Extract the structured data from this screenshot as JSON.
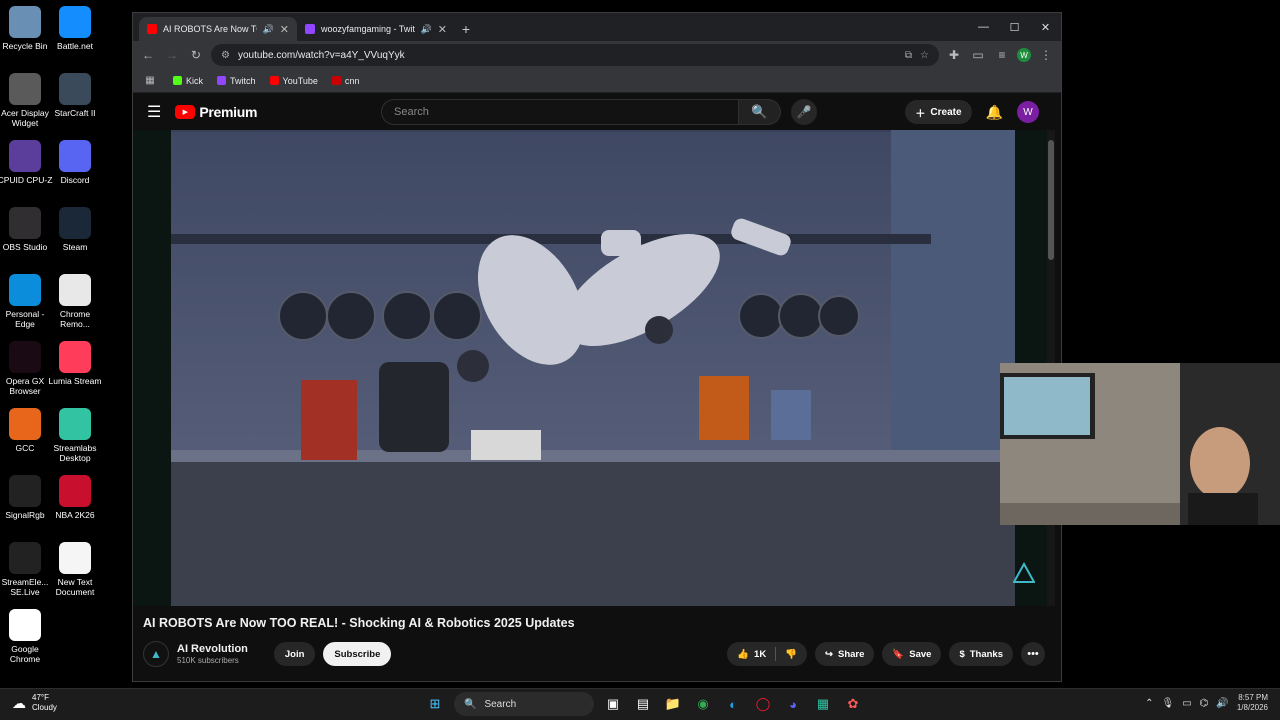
{
  "desktop": {
    "icons": [
      {
        "label": "Recycle Bin",
        "icon": "recycle-bin-icon",
        "color": "#6a8fb5"
      },
      {
        "label": "Battle.net",
        "icon": "battlenet-icon",
        "color": "#148eff"
      },
      {
        "label": "Acer Display Widget",
        "icon": "acer-icon",
        "color": "#5a5a5a"
      },
      {
        "label": "StarCraft II",
        "icon": "starcraft-icon",
        "color": "#3a4a5a"
      },
      {
        "label": "CPUID CPU-Z",
        "icon": "cpuz-icon",
        "color": "#5b3d9b"
      },
      {
        "label": "Discord",
        "icon": "discord-icon",
        "color": "#5865f2"
      },
      {
        "label": "OBS Studio",
        "icon": "obs-icon",
        "color": "#302e31"
      },
      {
        "label": "Steam",
        "icon": "steam-icon",
        "color": "#1b2838"
      },
      {
        "label": "Personal - Edge",
        "icon": "edge-icon",
        "color": "#0c8ddb"
      },
      {
        "label": "Chrome Remo...",
        "icon": "chrome-remote-icon",
        "color": "#e8e8e8"
      },
      {
        "label": "Opera GX Browser",
        "icon": "opera-gx-icon",
        "color": "#1a0a14"
      },
      {
        "label": "Lumia Stream",
        "icon": "lumia-icon",
        "color": "#ff3c5a"
      },
      {
        "label": "GCC",
        "icon": "gcc-icon",
        "color": "#e8661c"
      },
      {
        "label": "Streamlabs Desktop",
        "icon": "streamlabs-icon",
        "color": "#31c3a2"
      },
      {
        "label": "SignalRgb",
        "icon": "signalrgb-icon",
        "color": "#222"
      },
      {
        "label": "NBA 2K26",
        "icon": "nba2k-icon",
        "color": "#c8102e"
      },
      {
        "label": "StreamEle... SE.Live",
        "icon": "streamelements-icon",
        "color": "#222"
      },
      {
        "label": "New Text Document",
        "icon": "text-document-icon",
        "color": "#f5f5f5"
      },
      {
        "label": "Google Chrome",
        "icon": "chrome-icon",
        "color": "#ffffff"
      }
    ]
  },
  "browser": {
    "tabs": [
      {
        "title": "AI ROBOTS Are Now TOO R",
        "favicon_color": "#ff0000",
        "active": true
      },
      {
        "title": "woozyfamgaming - Twitch",
        "favicon_color": "#9146ff",
        "active": false
      }
    ],
    "url": "youtube.com/watch?v=a4Y_VVuqYyk",
    "profile_initial": "W",
    "bookmarks": [
      {
        "label": "Kick",
        "color": "#53fc18"
      },
      {
        "label": "Twitch",
        "color": "#9146ff"
      },
      {
        "label": "YouTube",
        "color": "#ff0000"
      },
      {
        "label": "cnn",
        "color": "#cc0000"
      }
    ]
  },
  "youtube": {
    "logo_text": "Premium",
    "search_placeholder": "Search",
    "create_label": "Create",
    "user_initial": "W",
    "video": {
      "title": "AI ROBOTS Are Now TOO REAL! - Shocking AI & Robotics 2025 Updates",
      "channel": "AI Revolution",
      "subscribers": "510K subscribers",
      "join_label": "Join",
      "subscribe_label": "Subscribe",
      "likes": "1K",
      "share_label": "Share",
      "save_label": "Save",
      "thanks_label": "Thanks"
    }
  },
  "taskbar": {
    "weather_temp": "47°F",
    "weather_desc": "Cloudy",
    "search_label": "Search",
    "time": "8:57 PM",
    "date": "1/8/2026"
  }
}
